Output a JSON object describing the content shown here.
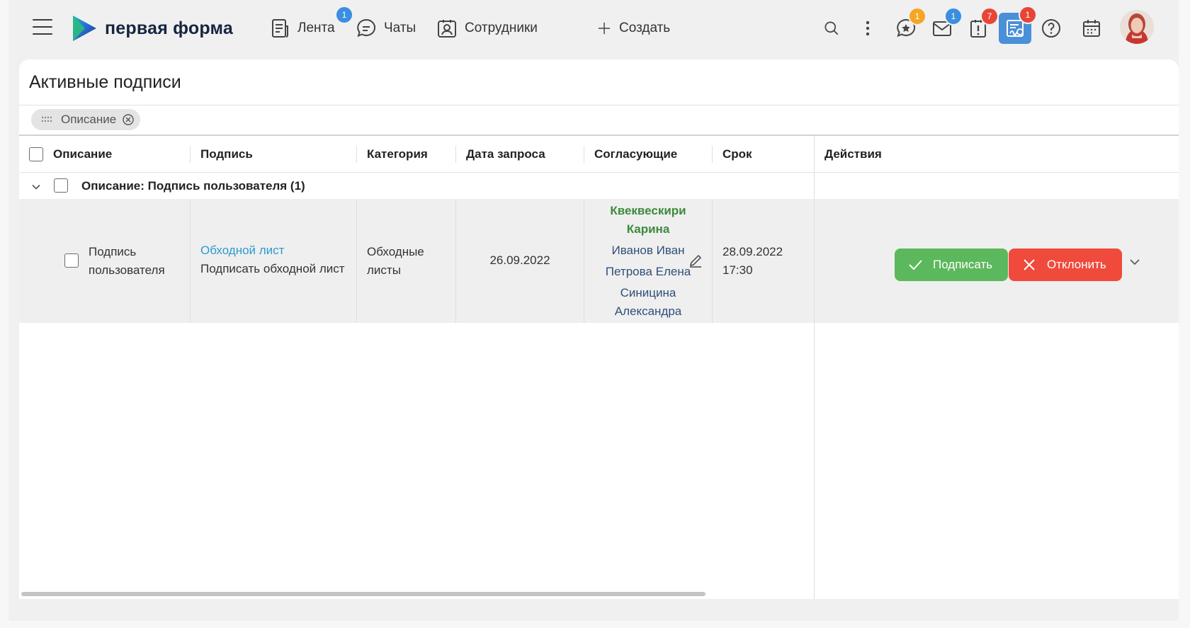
{
  "app": {
    "logo_text": "первая форма"
  },
  "nav": {
    "feed": {
      "label": "Лента",
      "badge": "1"
    },
    "chats": {
      "label": "Чаты"
    },
    "employees": {
      "label": "Сотрудники"
    },
    "create": {
      "label": "Создать"
    }
  },
  "toolbar_badges": {
    "favorites": "1",
    "mail": "1",
    "tasks": "7",
    "signatures": "1"
  },
  "colors": {
    "accent_blue": "#4a90d9",
    "badge_blue": "#3b8ee0",
    "badge_orange": "#f5a623",
    "badge_red": "#e84537",
    "sign_green": "#5cb85c",
    "reject_red": "#ef4a3c",
    "link_blue": "#2e9ad0"
  },
  "page": {
    "title": "Активные подписи",
    "filter_chip": "Описание"
  },
  "table": {
    "columns": [
      "Описание",
      "Подпись",
      "Категория",
      "Дата запроса",
      "Согласующие",
      "Срок",
      "Действия"
    ],
    "group_label": "Описание: Подпись пользователя (1)",
    "row": {
      "description_line1": "Подпись",
      "description_line2": "пользователя",
      "signature_link": "Обходной лист",
      "signature_text": "Подписать обходной лист",
      "category_line1": "Обходные",
      "category_line2": "листы",
      "request_date": "26.09.2022",
      "approvers": {
        "green_line1": "Квеквескири",
        "green_line2": "Карина",
        "blue1": "Иванов Иван",
        "blue2": "Петрова Елена",
        "blue3_line1": "Синицина",
        "blue3_line2": "Александра"
      },
      "deadline_date": "28.09.2022",
      "deadline_time": "17:30",
      "sign_button": "Подписать",
      "reject_button": "Отклонить"
    }
  }
}
